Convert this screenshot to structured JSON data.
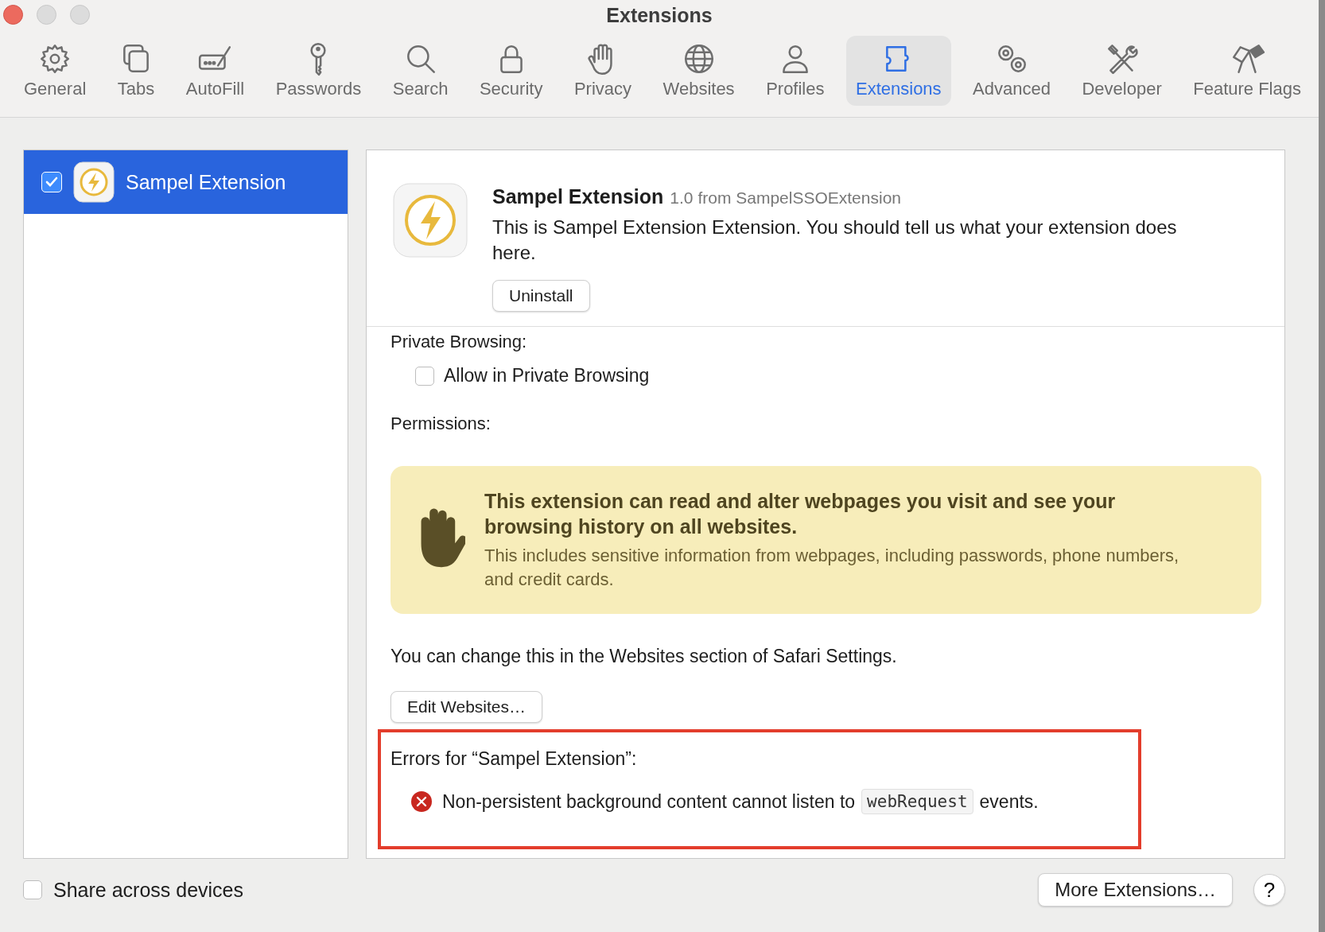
{
  "window": {
    "title": "Extensions"
  },
  "toolbar": [
    {
      "label": "General",
      "kind": "gear",
      "selected": false
    },
    {
      "label": "Tabs",
      "kind": "tabs",
      "selected": false
    },
    {
      "label": "AutoFill",
      "kind": "autofill",
      "selected": false
    },
    {
      "label": "Passwords",
      "kind": "key",
      "selected": false
    },
    {
      "label": "Search",
      "kind": "search",
      "selected": false
    },
    {
      "label": "Security",
      "kind": "lock",
      "selected": false
    },
    {
      "label": "Privacy",
      "kind": "hand",
      "selected": false
    },
    {
      "label": "Websites",
      "kind": "globe",
      "selected": false
    },
    {
      "label": "Profiles",
      "kind": "person",
      "selected": false
    },
    {
      "label": "Extensions",
      "kind": "puzzle",
      "selected": true
    },
    {
      "label": "Advanced",
      "kind": "gears",
      "selected": false
    },
    {
      "label": "Developer",
      "kind": "tools",
      "selected": false
    },
    {
      "label": "Feature Flags",
      "kind": "flags",
      "selected": false
    }
  ],
  "sidebar": {
    "items": [
      {
        "name": "Sampel Extension",
        "checked": true,
        "selected": true
      }
    ]
  },
  "detail": {
    "name": "Sampel Extension",
    "version": "1.0 from SampelSSOExtension",
    "description": "This is Sampel Extension Extension. You should tell us what your extension does here.",
    "uninstall_button": "Uninstall",
    "private_heading": "Private Browsing:",
    "private_option": {
      "label": "Allow in Private Browsing",
      "checked": false
    },
    "permissions_heading": "Permissions:",
    "warning": {
      "title": "This extension can read and alter webpages you visit and see your browsing history on all websites.",
      "body": "This includes sensitive information from webpages, including passwords, phone numbers, and credit cards."
    },
    "note": "You can change this in the Websites section of Safari Settings.",
    "edit_button": "Edit Websites…",
    "errors": {
      "heading": "Errors for “Sampel Extension”:",
      "items": [
        {
          "text_before": "Non-persistent background content cannot listen to",
          "code": "webRequest",
          "text_after": "events."
        }
      ]
    }
  },
  "footer": {
    "share_option": {
      "label": "Share across devices",
      "checked": false
    },
    "more_button": "More Extensions…",
    "help_button": "?"
  }
}
